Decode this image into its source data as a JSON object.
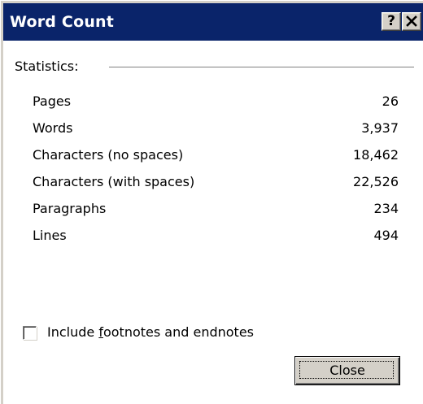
{
  "window": {
    "title": "Word Count",
    "help_button": "?",
    "close_icon": "close-icon"
  },
  "statistics": {
    "group_label": "Statistics:",
    "rows": [
      {
        "label": "Pages",
        "value": "26"
      },
      {
        "label": "Words",
        "value": "3,937"
      },
      {
        "label": "Characters (no spaces)",
        "value": "18,462"
      },
      {
        "label": "Characters (with spaces)",
        "value": "22,526"
      },
      {
        "label": "Paragraphs",
        "value": "234"
      },
      {
        "label": "Lines",
        "value": "494"
      }
    ]
  },
  "options": {
    "include_footnotes_label_pre": "Include ",
    "include_footnotes_label_accel": "f",
    "include_footnotes_label_post": "ootnotes and endnotes",
    "include_footnotes_checked": false
  },
  "buttons": {
    "close_label": "Close"
  },
  "colors": {
    "titlebar": "#0a246a",
    "face": "#d4d0c8",
    "background": "#ffffff"
  }
}
